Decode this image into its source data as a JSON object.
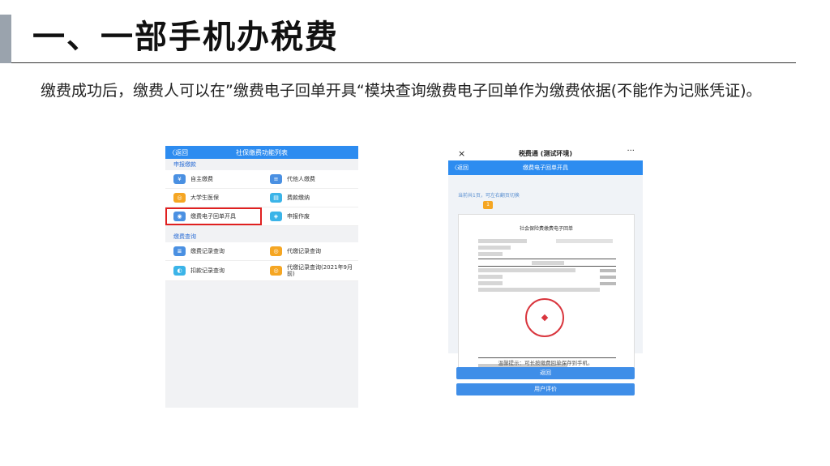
{
  "slide": {
    "title": "一、一部手机办税费",
    "paragraph": "缴费成功后，缴费人可以在”缴费电子回单开具“模块查询缴费电子回单作为缴费依据(不能作为记账凭证)。"
  },
  "phone1": {
    "back": "〈返回",
    "title": "社保缴费功能列表",
    "section1": "申报缴款",
    "section2": "缴费查询",
    "items": [
      {
        "label": "自主缴费",
        "icon": "self-pay-icon"
      },
      {
        "label": "代他人缴费",
        "icon": "pay-for-others-icon"
      },
      {
        "label": "大学生医保",
        "icon": "student-insurance-icon"
      },
      {
        "label": "费款缴纳",
        "icon": "fee-payment-icon"
      },
      {
        "label": "缴费电子回单开具",
        "icon": "receipt-icon"
      },
      {
        "label": "申报作废",
        "icon": "cancel-declaration-icon"
      },
      {
        "label": "缴费记录查询",
        "icon": "record-query-icon"
      },
      {
        "label": "代缴记录查询",
        "icon": "agent-record-icon"
      },
      {
        "label": "扣款记录查询",
        "icon": "deduction-record-icon"
      },
      {
        "label": "代缴记录查询(2021年9月前)",
        "icon": "old-agent-record-icon"
      }
    ],
    "highlight_color": "#e02020"
  },
  "phone2": {
    "close": "×",
    "nav_title": "税费通 (测试环境)",
    "more": "···",
    "back": "〈返回",
    "bar_title": "缴费电子回单开具",
    "hint": "当前共1页，可左右翻页切换",
    "page_badge": "1",
    "receipt_title": "社会保险费缴费电子回单",
    "tip": "温馨提示：可长按缴费回单保存到手机。",
    "btn_return": "返回",
    "btn_rate": "用户评价"
  },
  "colors": {
    "accent": "#2d8cf0",
    "stamp": "#d9363e"
  }
}
